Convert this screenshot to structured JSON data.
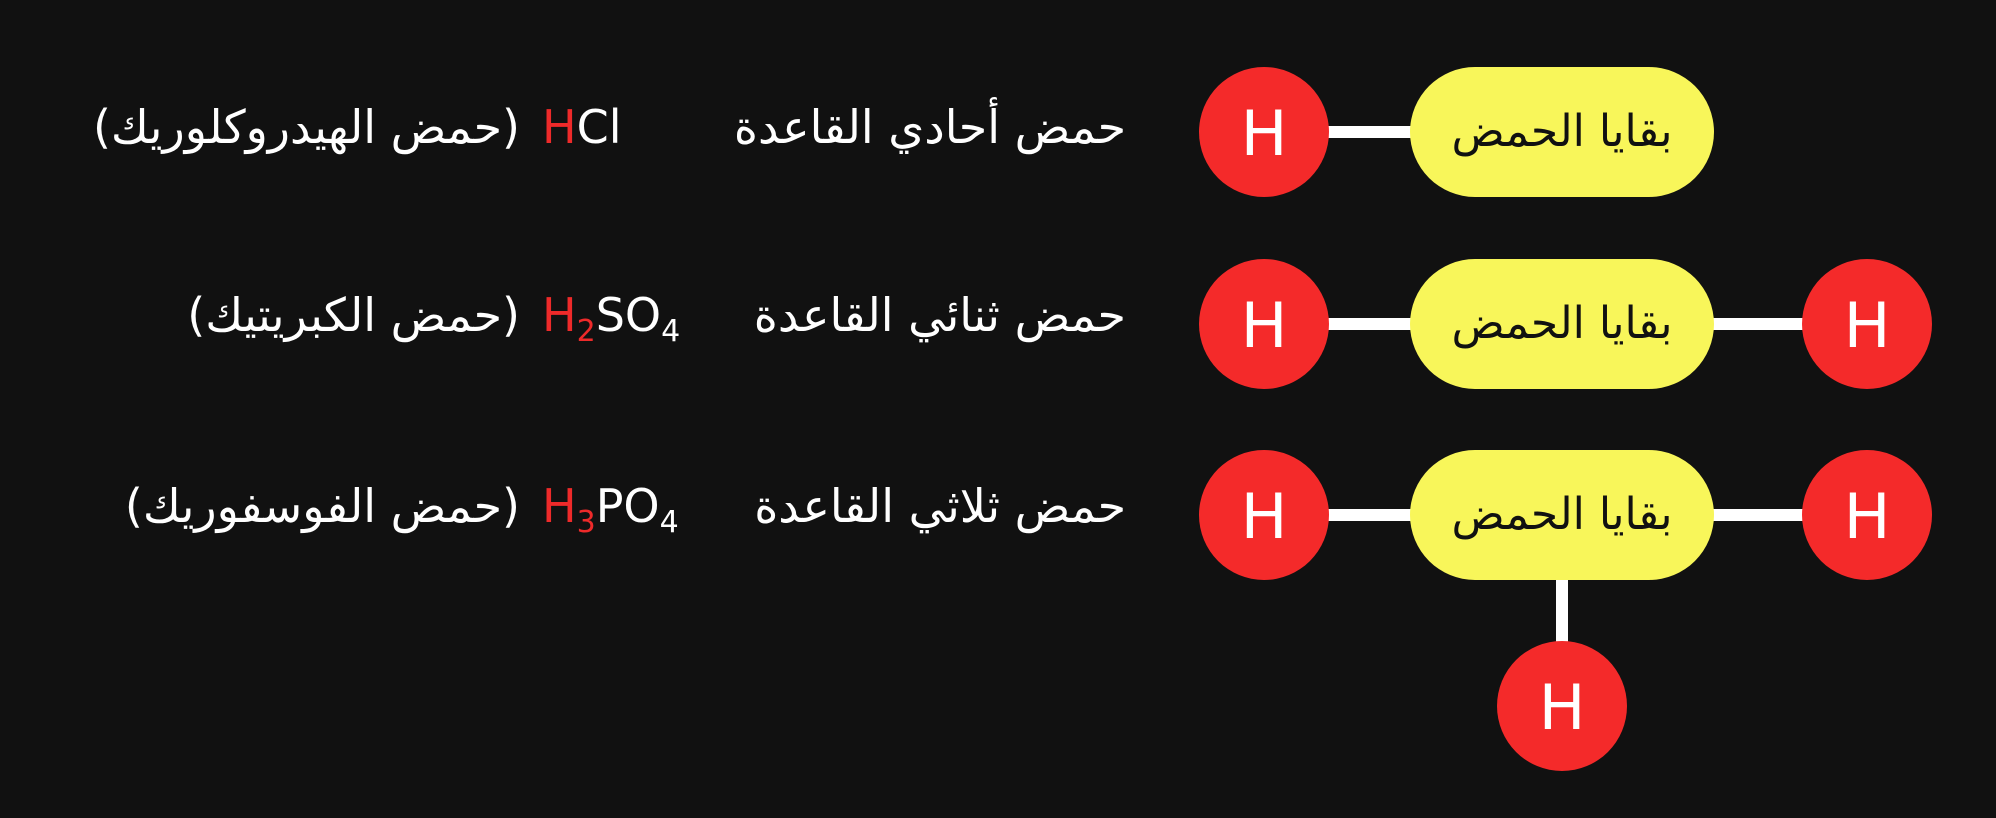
{
  "colors": {
    "background": "#111111",
    "hydrogen": "#f42a2a",
    "residue": "#f8f65a",
    "bond": "#ffffff",
    "text": "#ffffff",
    "formula_h": "#ee2a2a"
  },
  "atom_symbol": "H",
  "residue_label": "بقايا الحمض",
  "rows": [
    {
      "type_label": "حمض أحادي القاعدة",
      "formula": {
        "h": "H",
        "h_sub": "",
        "rest": "Cl",
        "rest_sub": ""
      },
      "name": "(حمض الهيدروكلوريك)",
      "hydrogen_count": 1
    },
    {
      "type_label": "حمض ثنائي القاعدة",
      "formula": {
        "h": "H",
        "h_sub": "2",
        "rest": "SO",
        "rest_sub": "4"
      },
      "name": "(حمض الكبريتيك)",
      "hydrogen_count": 2
    },
    {
      "type_label": "حمض ثلاثي القاعدة",
      "formula": {
        "h": "H",
        "h_sub": "3",
        "rest": "PO",
        "rest_sub": "4"
      },
      "name": "(حمض الفوسفوريك)",
      "hydrogen_count": 3
    }
  ]
}
